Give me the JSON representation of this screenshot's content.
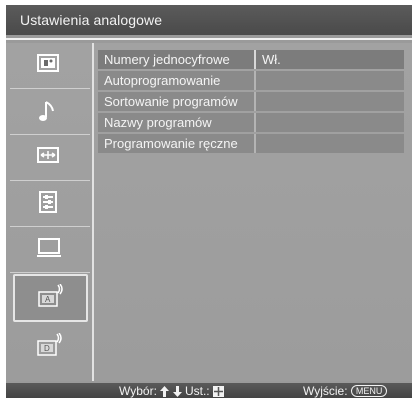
{
  "title": "Ustawienia analogowe",
  "sidebar": {
    "items": [
      {
        "icon": "picture-icon"
      },
      {
        "icon": "sound-icon"
      },
      {
        "icon": "screen-icon"
      },
      {
        "icon": "setup-icon"
      },
      {
        "icon": "pc-icon"
      },
      {
        "icon": "analog-setup-icon",
        "selected": true
      },
      {
        "icon": "digital-setup-icon"
      }
    ]
  },
  "menu": {
    "items": [
      {
        "label": "Numery jednocyfrowe",
        "value": "Wł."
      },
      {
        "label": "Autoprogramowanie",
        "value": ""
      },
      {
        "label": "Sortowanie programów",
        "value": ""
      },
      {
        "label": "Nazwy programów",
        "value": ""
      },
      {
        "label": "Programowanie ręczne",
        "value": ""
      }
    ]
  },
  "footer": {
    "select_label": "Wybór:",
    "confirm_label": "Ust.:",
    "exit_label": "Wyjście:",
    "exit_button": "MENU"
  },
  "colors": {
    "background": "#9a9a9a",
    "titlebar": "#4f4f4f",
    "highlight": "#7c7c7c",
    "text": "#f4f4f4"
  }
}
